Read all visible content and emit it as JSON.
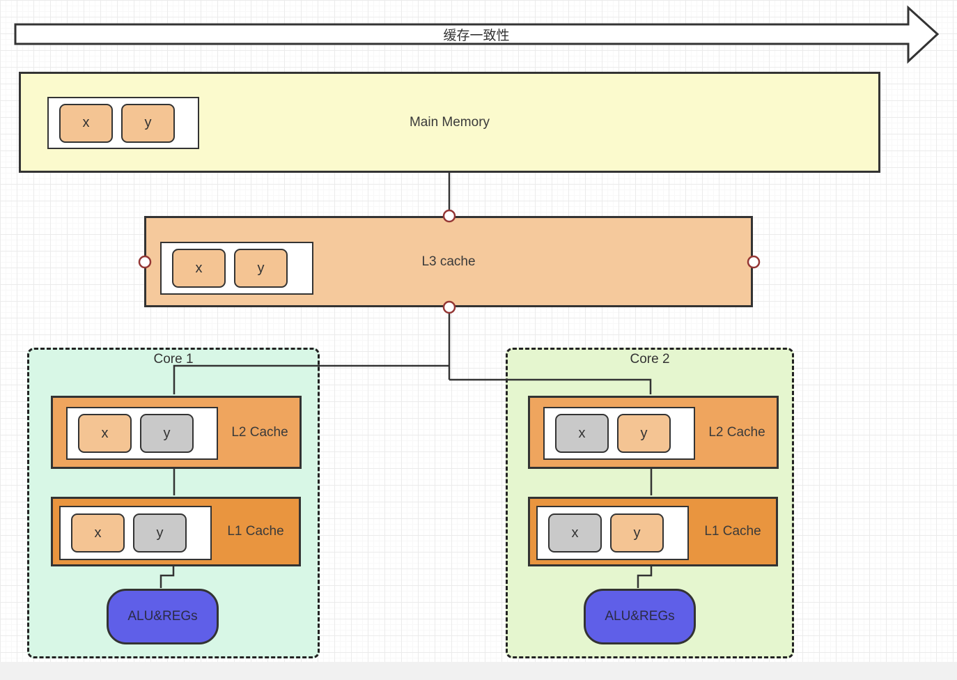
{
  "arrow": {
    "label": "缓存一致性"
  },
  "main_memory": {
    "label": "Main Memory",
    "cells": [
      {
        "label": "x",
        "variant": "orange"
      },
      {
        "label": "y",
        "variant": "orange"
      }
    ]
  },
  "l3_cache": {
    "label": "L3 cache",
    "cells": [
      {
        "label": "x",
        "variant": "orange"
      },
      {
        "label": "y",
        "variant": "orange"
      }
    ]
  },
  "cores": [
    {
      "title": "Core 1",
      "l2": {
        "label": "L2 Cache",
        "cells": [
          {
            "label": "x",
            "variant": "orange"
          },
          {
            "label": "y",
            "variant": "gray"
          }
        ]
      },
      "l1": {
        "label": "L1 Cache",
        "cells": [
          {
            "label": "x",
            "variant": "orange"
          },
          {
            "label": "y",
            "variant": "gray"
          }
        ]
      },
      "alu": {
        "label": "ALU&REGs"
      }
    },
    {
      "title": "Core 2",
      "l2": {
        "label": "L2 Cache",
        "cells": [
          {
            "label": "x",
            "variant": "gray"
          },
          {
            "label": "y",
            "variant": "orange"
          }
        ]
      },
      "l1": {
        "label": "L1 Cache",
        "cells": [
          {
            "label": "x",
            "variant": "gray"
          },
          {
            "label": "y",
            "variant": "orange"
          }
        ]
      },
      "alu": {
        "label": "ALU&REGs"
      }
    }
  ],
  "colors": {
    "main_memory_fill": "#fbfacd",
    "l3_fill": "#f5c99c",
    "l2_fill": "#efa55e",
    "l1_fill": "#e9953f",
    "cell_orange": "#f4c493",
    "cell_gray": "#c9c9c9",
    "core1_fill": "#d8f7e6",
    "core2_fill": "#e5f6cf",
    "alu_fill": "#5f5fe8",
    "connection_point_stroke": "#943634",
    "line_color": "#333333"
  }
}
